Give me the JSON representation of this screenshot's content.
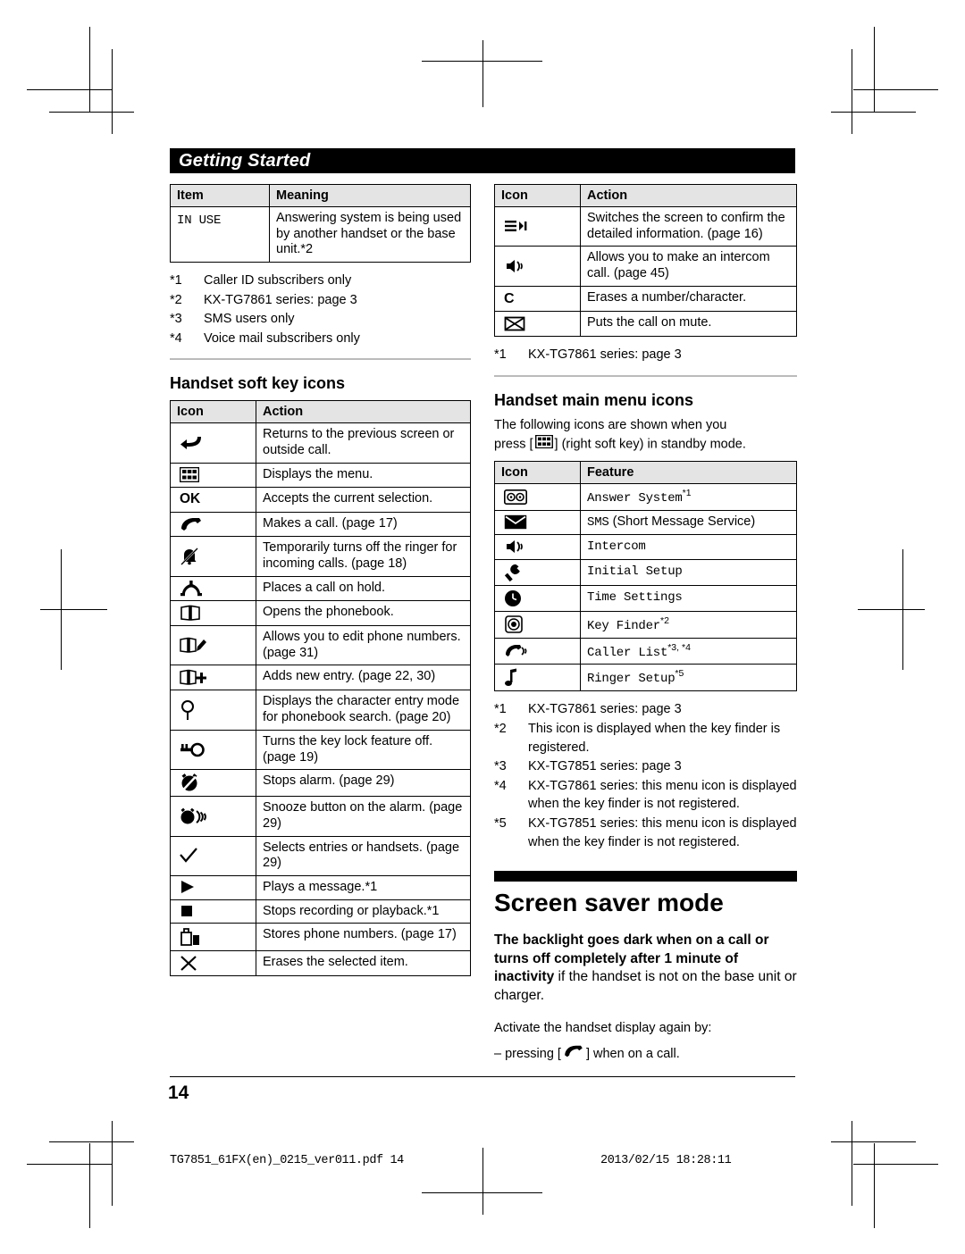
{
  "header": {
    "title": "Getting Started"
  },
  "left": {
    "table1": {
      "headers": [
        "Item",
        "Meaning"
      ],
      "rows": [
        {
          "item": "IN USE",
          "meaning": "Answering system is being used by another handset or the base unit.*2"
        }
      ]
    },
    "footnotes1": [
      {
        "mark": "*1",
        "text": "Caller ID subscribers only"
      },
      {
        "mark": "*2",
        "text": "KX-TG7861 series: page 3"
      },
      {
        "mark": "*3",
        "text": "SMS users only"
      },
      {
        "mark": "*4",
        "text": "Voice mail subscribers only"
      }
    ],
    "section_title": "Handset soft key icons",
    "table2": {
      "headers": [
        "Icon",
        "Action"
      ],
      "rows": [
        {
          "icon": "back-arrow-icon",
          "action": "Returns to the previous screen or outside call."
        },
        {
          "icon": "menu-grid-icon",
          "action": "Displays the menu."
        },
        {
          "icon": "ok-text-icon",
          "action": "Accepts the current selection."
        },
        {
          "icon": "handset-call-icon",
          "action": "Makes a call. (page 17)"
        },
        {
          "icon": "ringer-off-icon",
          "action": "Temporarily turns off the ringer for incoming calls. (page 18)"
        },
        {
          "icon": "call-hold-icon",
          "action": "Places a call on hold."
        },
        {
          "icon": "phonebook-icon",
          "action": "Opens the phonebook."
        },
        {
          "icon": "phonebook-edit-icon",
          "action": "Allows you to edit phone numbers. (page 31)"
        },
        {
          "icon": "phonebook-add-icon",
          "action": "Adds new entry. (page 22, 30)"
        },
        {
          "icon": "search-icon",
          "action": "Displays the character entry mode for phonebook search. (page 20)"
        },
        {
          "icon": "key-unlock-icon",
          "action": "Turns the key lock feature off. (page 19)"
        },
        {
          "icon": "alarm-stop-icon",
          "action": "Stops alarm. (page 29)"
        },
        {
          "icon": "snooze-icon",
          "action": "Snooze button on the alarm. (page 29)"
        },
        {
          "icon": "check-icon",
          "action": "Selects entries or handsets. (page 29)"
        },
        {
          "icon": "play-icon",
          "action": "Plays a message.*1"
        },
        {
          "icon": "stop-icon",
          "action": "Stops recording or playback.*1"
        },
        {
          "icon": "save-number-icon",
          "action": "Stores phone numbers. (page 17)"
        },
        {
          "icon": "erase-x-icon",
          "action": "Erases the selected item."
        }
      ]
    }
  },
  "right": {
    "table1": {
      "headers": [
        "Icon",
        "Action"
      ],
      "rows": [
        {
          "icon": "detail-list-icon",
          "action": "Switches the screen to confirm the detailed information. (page 16)"
        },
        {
          "icon": "intercom-icon",
          "action": "Allows you to make an intercom call. (page 45)"
        },
        {
          "icon": "c-clear-icon",
          "action": "Erases a number/character."
        },
        {
          "icon": "mute-icon",
          "action": "Puts the call on mute."
        }
      ]
    },
    "footnote1": {
      "mark": "*1",
      "text": "KX-TG7861 series: page 3"
    },
    "section_title": "Handset main menu icons",
    "intro_a": "The following icons are shown when you",
    "intro_b": "press [",
    "intro_c": "] (right soft key) in standby mode.",
    "table2": {
      "headers": [
        "Icon",
        "Feature"
      ],
      "rows": [
        {
          "icon": "answer-system-icon",
          "feature": "Answer System",
          "sup": "*1"
        },
        {
          "icon": "sms-envelope-icon",
          "feature": "SMS",
          "feature_extra": " (Short Message Service)",
          "sup": ""
        },
        {
          "icon": "intercom-icon",
          "feature": "Intercom",
          "sup": ""
        },
        {
          "icon": "wrench-icon",
          "feature": "Initial Setup",
          "sup": ""
        },
        {
          "icon": "clock-icon",
          "feature": "Time Settings",
          "sup": ""
        },
        {
          "icon": "key-finder-icon",
          "feature": "Key Finder",
          "sup": "*2"
        },
        {
          "icon": "caller-list-icon",
          "feature": "Caller List",
          "sup": "*3, *4"
        },
        {
          "icon": "ringer-note-icon",
          "feature": "Ringer Setup",
          "sup": "*5"
        }
      ]
    },
    "footnotes2": [
      {
        "mark": "*1",
        "text": "KX-TG7861 series: page 3"
      },
      {
        "mark": "*2",
        "text": "This icon is displayed when the key finder is registered."
      },
      {
        "mark": "*3",
        "text": "KX-TG7851 series: page 3"
      },
      {
        "mark": "*4",
        "text": "KX-TG7861 series: this menu icon is displayed when the key finder is not registered."
      },
      {
        "mark": "*5",
        "text": "KX-TG7851 series: this menu icon is displayed when the key finder is not registered."
      }
    ],
    "screensaver": {
      "title": "Screen saver mode",
      "bold_text": "The backlight goes dark when on a call or turns off completely after 1 minute of inactivity",
      "bold_tail": " if the handset is not on the base unit or charger.",
      "line2": "Activate the handset display again by:",
      "line3_a": "–   pressing [",
      "line3_b": "] when on a call."
    }
  },
  "footer": {
    "page_number": "14",
    "file_line": "TG7851_61FX(en)_0215_ver011.pdf    14",
    "date_line": "2013/02/15   18:28:11"
  }
}
